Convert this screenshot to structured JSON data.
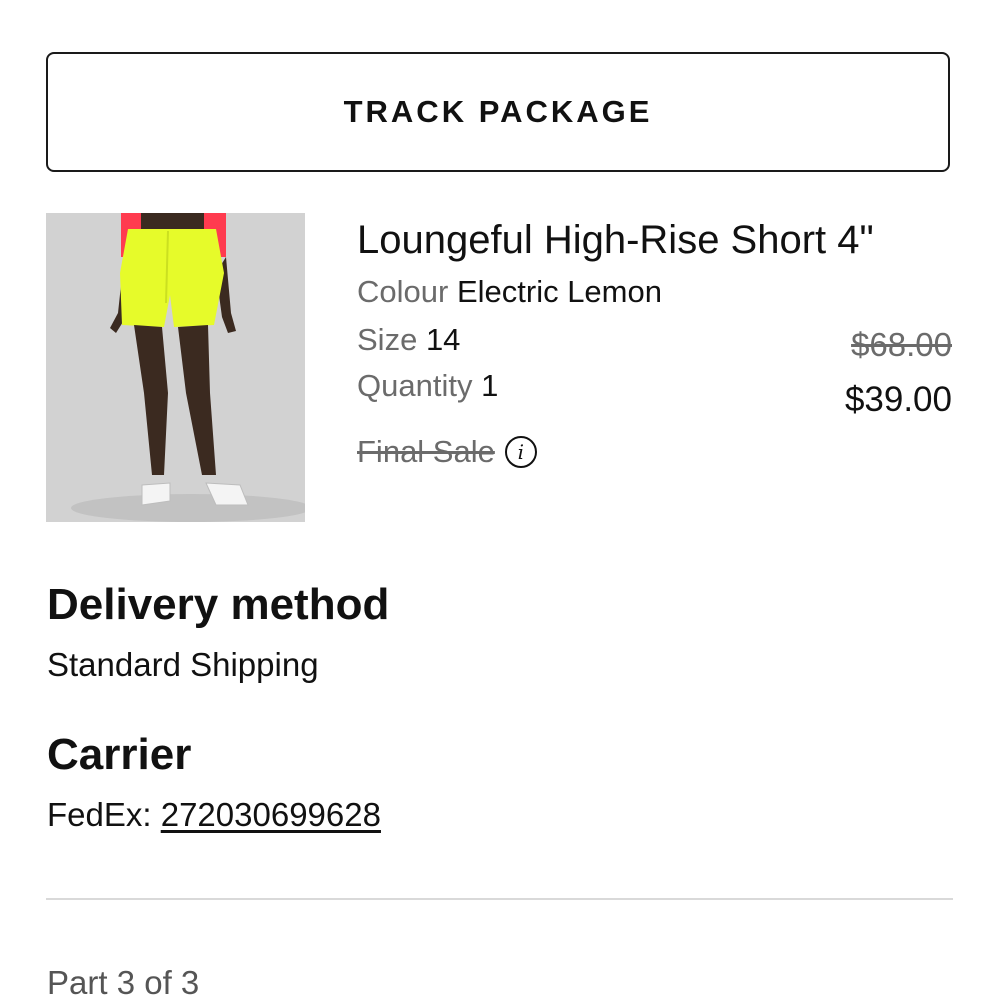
{
  "track_button": {
    "label": "TRACK PACKAGE"
  },
  "item": {
    "name": "Loungeful High-Rise Short 4\"",
    "colour_label": "Colour",
    "colour_value": "Electric Lemon",
    "size_label": "Size",
    "size_value": "14",
    "quantity_label": "Quantity",
    "quantity_value": "1",
    "final_sale": "Final Sale",
    "info_icon": "info-icon",
    "price_original": "$68.00",
    "price_sale": "$39.00",
    "image_colors": {
      "shorts": "#e6fb2a",
      "sleeve": "#ff3b4f",
      "background": "#d2d2d2"
    }
  },
  "delivery": {
    "heading": "Delivery method",
    "value": "Standard Shipping"
  },
  "carrier": {
    "heading": "Carrier",
    "name": "FedEx:",
    "tracking_number": "272030699628"
  },
  "part": {
    "label": "Part 3 of 3"
  }
}
